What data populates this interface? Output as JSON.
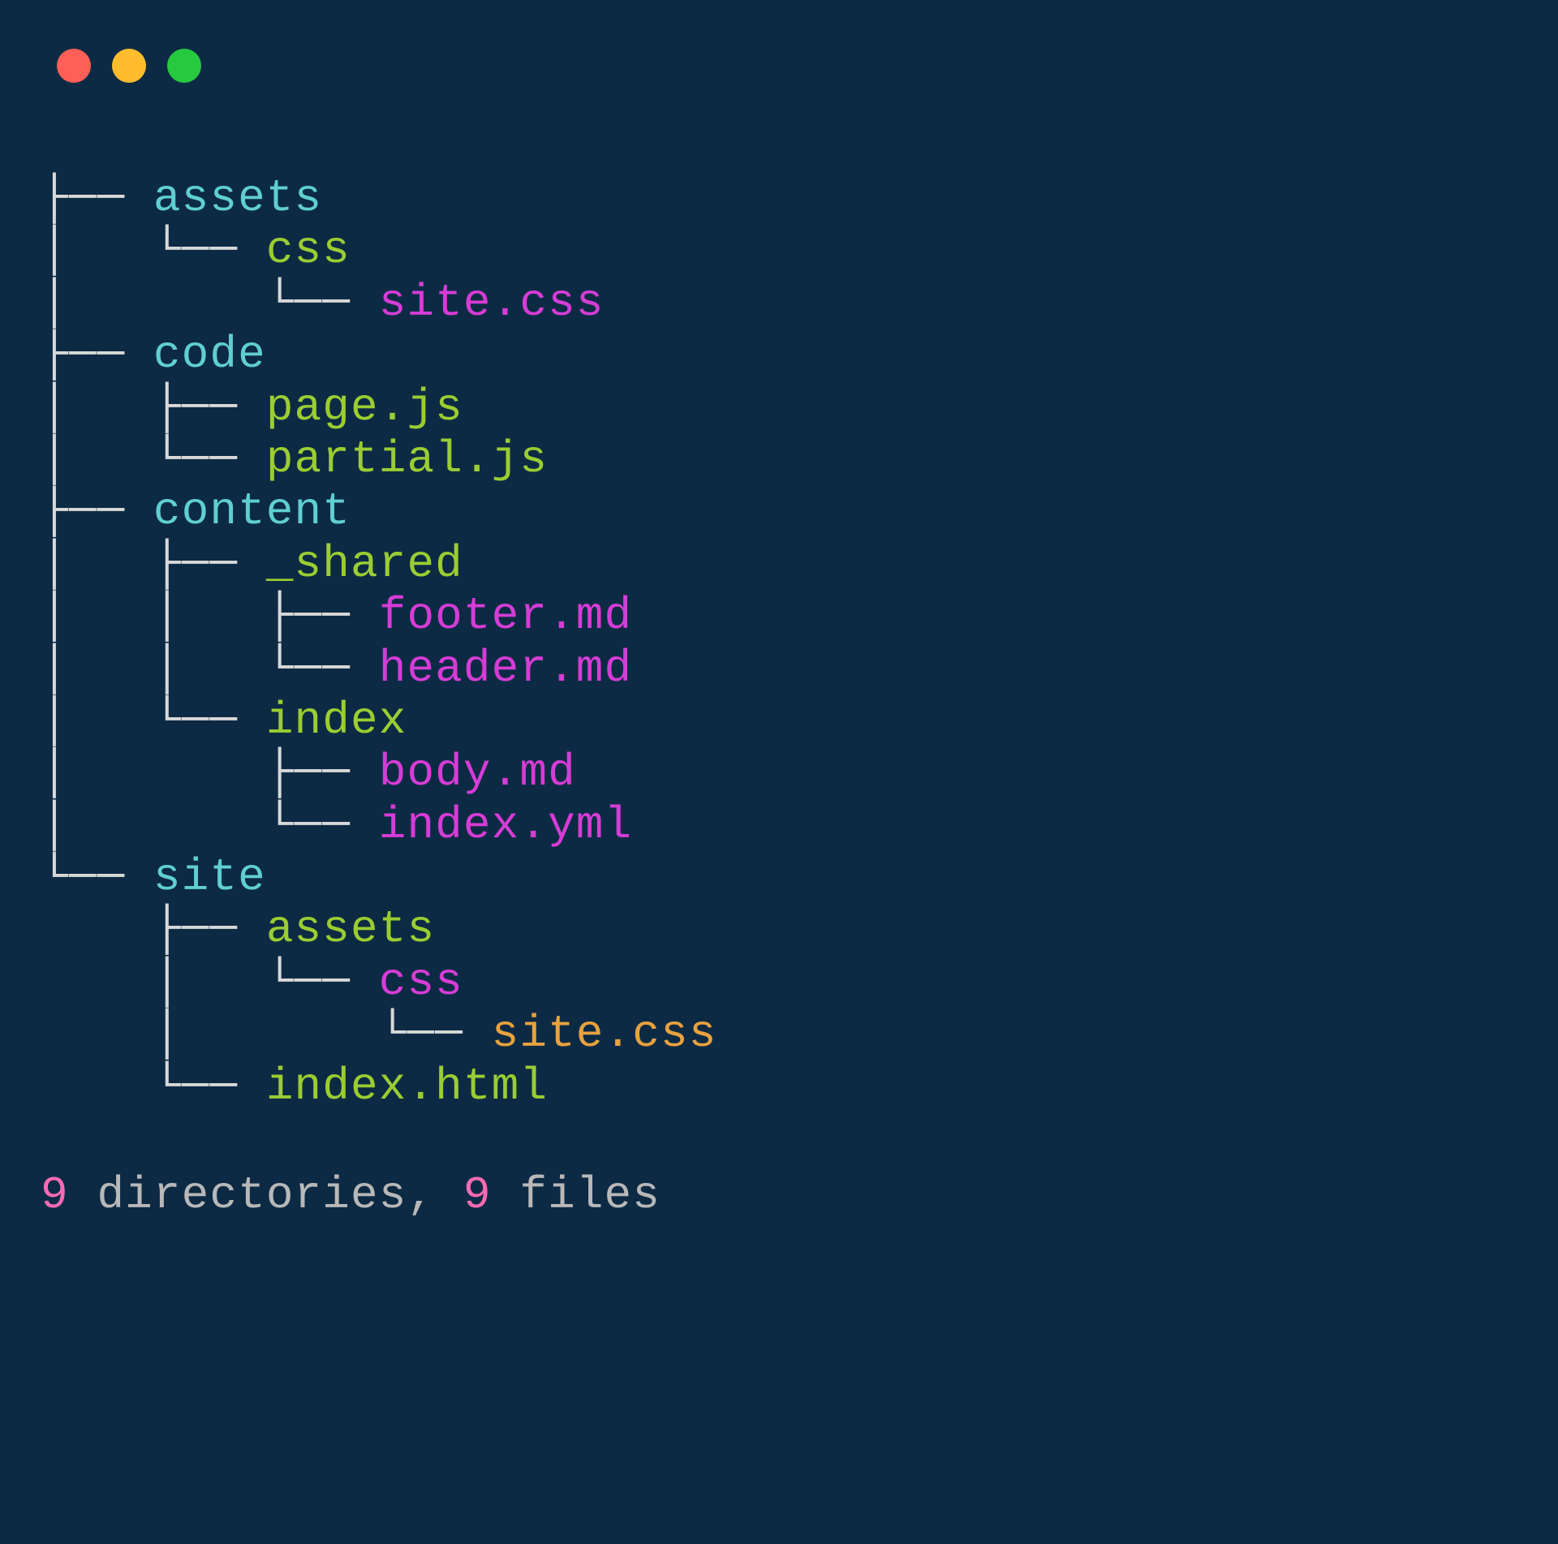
{
  "window": {
    "dots": {
      "red": "#ff5f56",
      "yellow": "#ffbd2e",
      "green": "#27c93f"
    }
  },
  "tree": {
    "lines": [
      {
        "prefix": "├── ",
        "name": "assets",
        "color": "cyan"
      },
      {
        "prefix": "│   └── ",
        "name": "css",
        "color": "green"
      },
      {
        "prefix": "│       └── ",
        "name": "site.css",
        "color": "magenta"
      },
      {
        "prefix": "├── ",
        "name": "code",
        "color": "cyan"
      },
      {
        "prefix": "│   ├── ",
        "name": "page.js",
        "color": "green"
      },
      {
        "prefix": "│   └── ",
        "name": "partial.js",
        "color": "green"
      },
      {
        "prefix": "├── ",
        "name": "content",
        "color": "cyan"
      },
      {
        "prefix": "│   ├── ",
        "name": "_shared",
        "color": "green"
      },
      {
        "prefix": "│   │   ├── ",
        "name": "footer.md",
        "color": "magenta"
      },
      {
        "prefix": "│   │   └── ",
        "name": "header.md",
        "color": "magenta"
      },
      {
        "prefix": "│   └── ",
        "name": "index",
        "color": "green"
      },
      {
        "prefix": "│       ├── ",
        "name": "body.md",
        "color": "magenta"
      },
      {
        "prefix": "│       └── ",
        "name": "index.yml",
        "color": "magenta"
      },
      {
        "prefix": "└── ",
        "name": "site",
        "color": "cyan"
      },
      {
        "prefix": "    ├── ",
        "name": "assets",
        "color": "green"
      },
      {
        "prefix": "    │   └── ",
        "name": "css",
        "color": "magenta"
      },
      {
        "prefix": "    │       └── ",
        "name": "site.css",
        "color": "orange"
      },
      {
        "prefix": "    └── ",
        "name": "index.html",
        "color": "green"
      }
    ]
  },
  "summary": {
    "dir_count": "9",
    "dir_label": " directories, ",
    "file_count": "9",
    "file_label": " files"
  }
}
